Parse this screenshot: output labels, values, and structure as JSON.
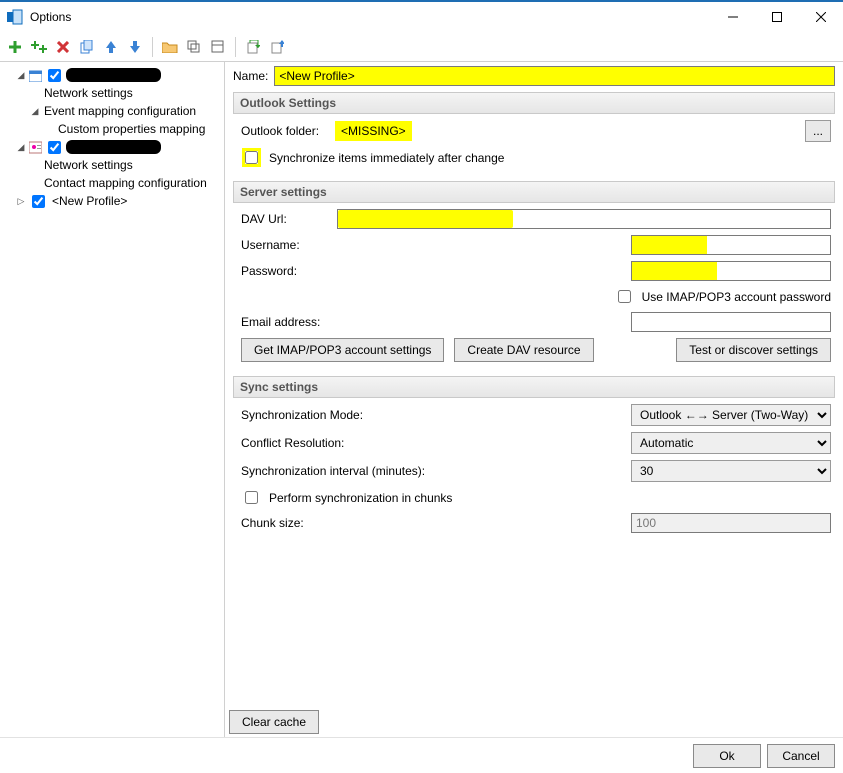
{
  "window": {
    "title": "Options"
  },
  "toolbar_icons": [
    "add",
    "add-multi",
    "delete",
    "copy",
    "up",
    "down",
    "open-folder",
    "s1",
    "s2",
    "s3",
    "s4"
  ],
  "tree": {
    "root": [
      {
        "redacted": true,
        "expanded": true,
        "kind": "calendar",
        "children": [
          {
            "label": "Network settings"
          },
          {
            "label": "Event mapping configuration",
            "expanded": true,
            "children": [
              {
                "label": "Custom properties mapping"
              }
            ]
          }
        ]
      },
      {
        "redacted": true,
        "expanded": true,
        "kind": "contact",
        "children": [
          {
            "label": "Network settings"
          },
          {
            "label": "Contact mapping configuration"
          }
        ]
      },
      {
        "label": "<New Profile>",
        "checkbox": true,
        "expanded": false
      }
    ]
  },
  "form": {
    "name_label": "Name:",
    "name_value": "<New Profile>",
    "outlook": {
      "section_title": "Outlook Settings",
      "folder_label": "Outlook folder:",
      "folder_value": "<MISSING>",
      "browse_label": "...",
      "sync_imm_label": "Synchronize items immediately after change"
    },
    "server": {
      "section_title": "Server settings",
      "dav_label": "DAV Url:",
      "dav_value": "",
      "username_label": "Username:",
      "username_value": "",
      "password_label": "Password:",
      "password_value": "",
      "use_imap_label": "Use IMAP/POP3 account password",
      "email_label": "Email address:",
      "email_value": "",
      "btn_get_imap": "Get IMAP/POP3 account settings",
      "btn_create_dav": "Create DAV resource",
      "btn_test": "Test or discover settings"
    },
    "sync": {
      "section_title": "Sync settings",
      "mode_label": "Synchronization Mode:",
      "mode_value": "Outlook ←→ Server (Two-Way)",
      "conflict_label": "Conflict Resolution:",
      "conflict_value": "Automatic",
      "interval_label": "Synchronization interval (minutes):",
      "interval_value": "30",
      "chunks_label": "Perform synchronization in chunks",
      "chunk_size_label": "Chunk size:",
      "chunk_size_value": "100"
    },
    "clear_cache": "Clear cache"
  },
  "footer": {
    "ok": "Ok",
    "cancel": "Cancel"
  }
}
